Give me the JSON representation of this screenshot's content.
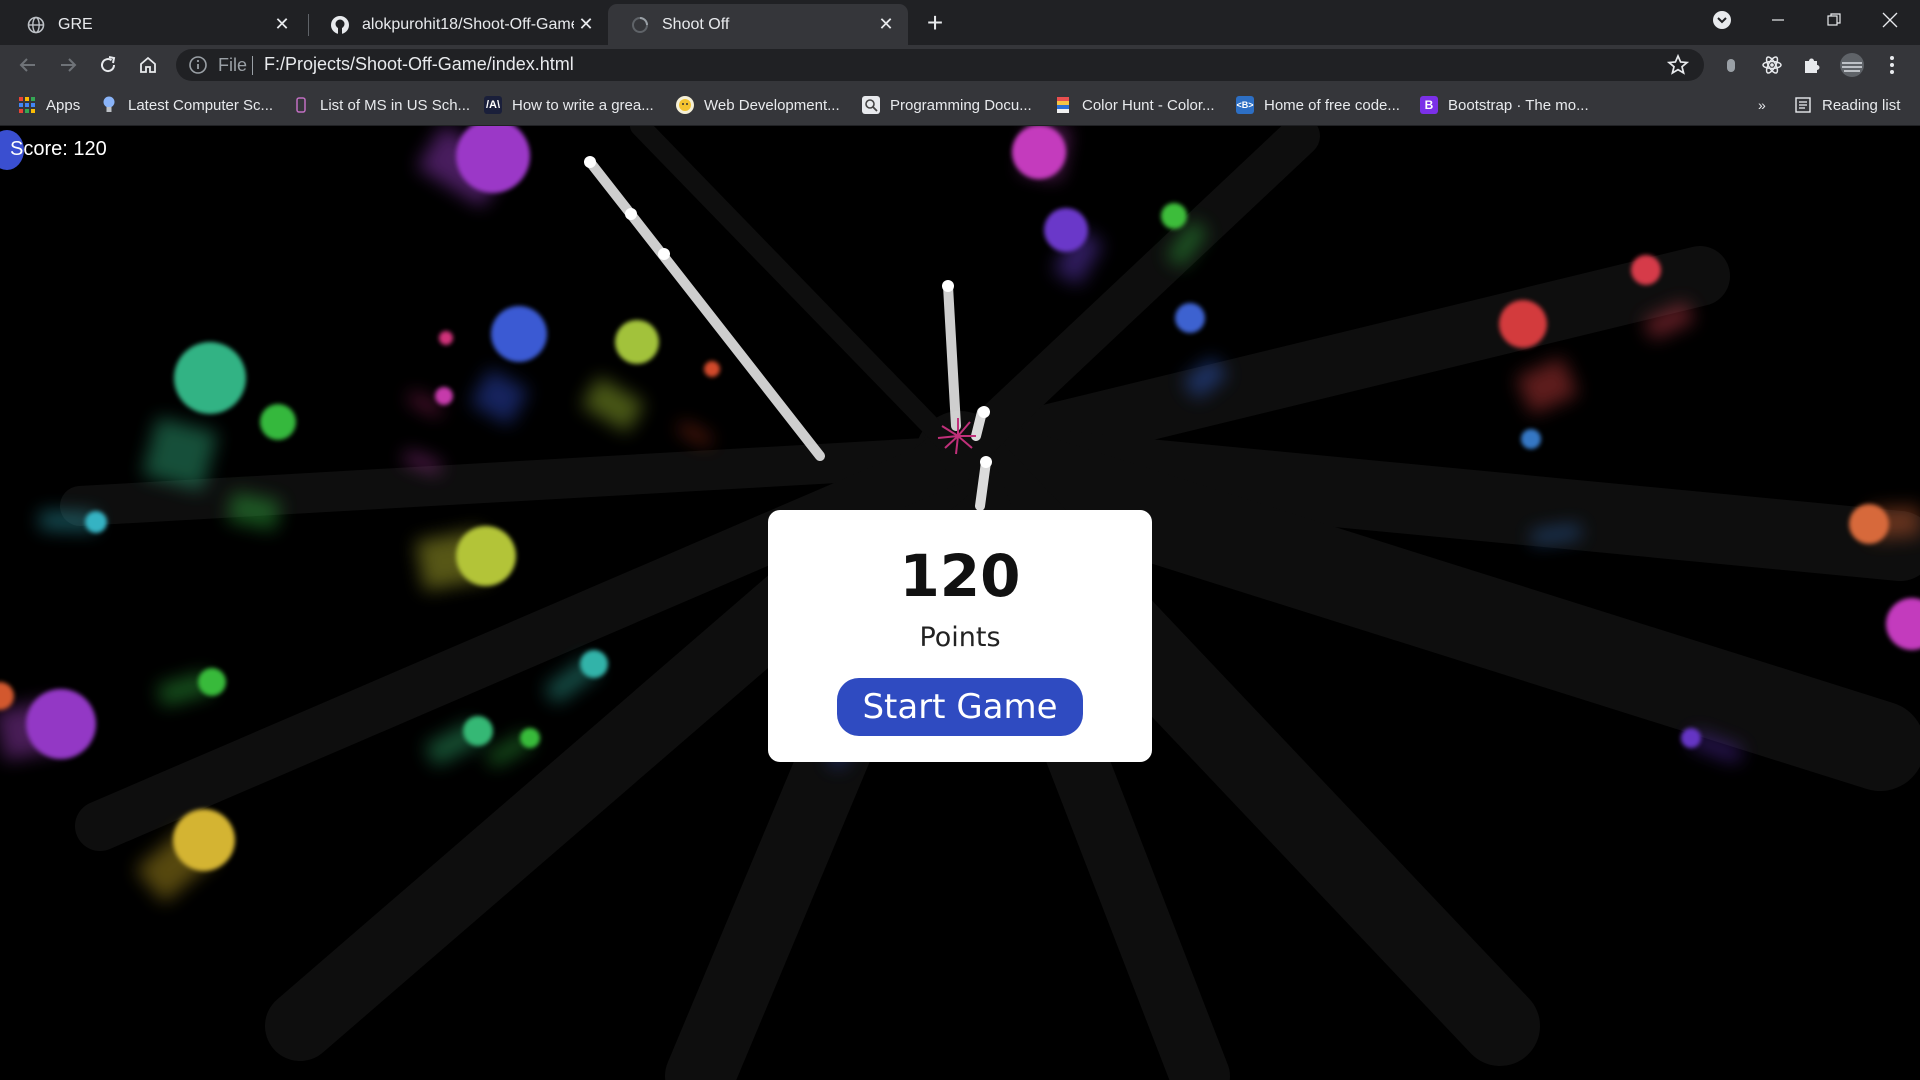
{
  "browser": {
    "tabs": [
      {
        "title": "GRE",
        "icon": "globe-icon",
        "active": false
      },
      {
        "title": "alokpurohit18/Shoot-Off-Game: ",
        "icon": "github-icon",
        "active": false
      },
      {
        "title": "Shoot Off",
        "icon": "globe-loading-icon",
        "active": true
      }
    ],
    "omnibox": {
      "scheme": "File",
      "url": "F:/Projects/Shoot-Off-Game/index.html"
    },
    "bookmarks": [
      {
        "label": "Apps",
        "icon": "apps-grid-icon"
      },
      {
        "label": "Latest Computer Sc...",
        "icon": "bulb-icon"
      },
      {
        "label": "List of MS in US Sch...",
        "icon": "doc-icon"
      },
      {
        "label": "How to write a grea...",
        "icon": "a-logo-icon"
      },
      {
        "label": "Web Development...",
        "icon": "emoji-icon"
      },
      {
        "label": "Programming Docu...",
        "icon": "search-doc-icon"
      },
      {
        "label": "Color Hunt - Color...",
        "icon": "colorhunt-icon"
      },
      {
        "label": "Home of free code...",
        "icon": "code-icon"
      },
      {
        "label": "Bootstrap · The mo...",
        "icon": "bootstrap-icon"
      }
    ],
    "bookmarks_overflow": "»",
    "reading_list": "Reading list"
  },
  "game": {
    "score_label": "Score: 120",
    "modal": {
      "score": "120",
      "label": "Points",
      "button": "Start Game"
    },
    "colors": {
      "background": "#000000",
      "button": "#2f4bc1",
      "player": "#ffffff"
    }
  }
}
